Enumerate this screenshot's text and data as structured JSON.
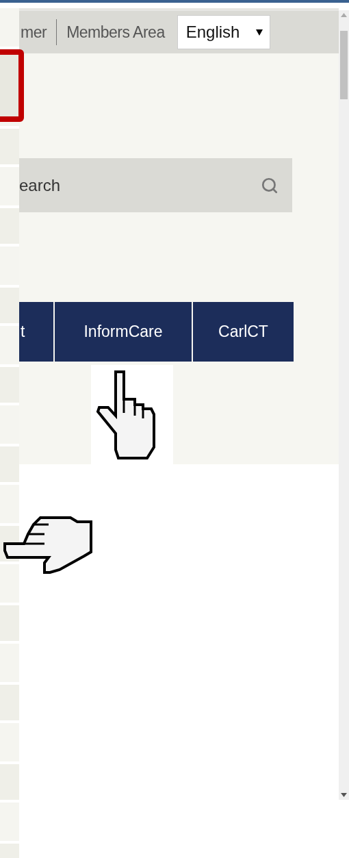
{
  "header": {
    "links": [
      "mer",
      "Members Area"
    ],
    "language": "English"
  },
  "search": {
    "placeholder": "earch"
  },
  "nav": [
    {
      "label": "t"
    },
    {
      "label": "InformCare"
    },
    {
      "label": "CarlCT"
    }
  ]
}
